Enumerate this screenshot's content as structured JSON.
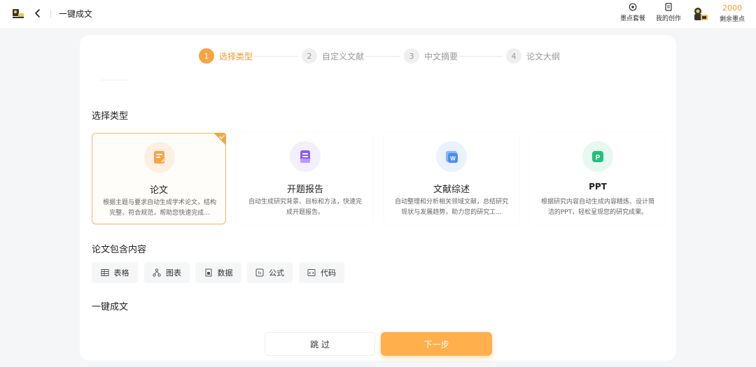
{
  "header": {
    "title": "一键成文",
    "tools": [
      {
        "label": "墨点套餐",
        "icon": "package-icon"
      },
      {
        "label": "我的创作",
        "icon": "document-icon"
      }
    ],
    "points_value": "2000",
    "points_label": "剩余墨点"
  },
  "steps": [
    {
      "num": "1",
      "label": "选择类型",
      "active": true
    },
    {
      "num": "2",
      "label": "自定义文献",
      "active": false
    },
    {
      "num": "3",
      "label": "中文摘要",
      "active": false
    },
    {
      "num": "4",
      "label": "论文大纲",
      "active": false
    }
  ],
  "select_type": {
    "title": "选择类型",
    "cards": [
      {
        "name": "论文",
        "desc": "根据主题与要求自动生成学术论文，结构完整、符合规范，帮助您快速完成...",
        "icon": "paper-icon",
        "color": "#f7a445",
        "selected": true
      },
      {
        "name": "开题报告",
        "desc": "自动生成研究背景、目标和方法，快速完成开题报告。",
        "icon": "report-icon",
        "color": "#8b5cf6",
        "selected": false
      },
      {
        "name": "文献综述",
        "desc": "自动整理和分析相关领域文献，总结研究现状与发展趋势，助力您的研究工...",
        "icon": "word-icon",
        "color": "#4b8df5",
        "selected": false
      },
      {
        "name": "PPT",
        "desc": "根据研究内容自动生成内容精炼、设计简洁的PPT，轻松呈现您的研究成果。",
        "icon": "ppt-icon",
        "color": "#22c07a",
        "selected": false
      }
    ]
  },
  "content": {
    "title": "论文包含内容",
    "chips": [
      {
        "label": "表格",
        "icon": "table-icon"
      },
      {
        "label": "图表",
        "icon": "chart-icon"
      },
      {
        "label": "数据",
        "icon": "data-icon"
      },
      {
        "label": "公式",
        "icon": "formula-icon"
      },
      {
        "label": "代码",
        "icon": "code-icon"
      }
    ]
  },
  "one_click": {
    "title": "一键成文"
  },
  "actions": {
    "skip": "跳 过",
    "next": "下一步"
  }
}
